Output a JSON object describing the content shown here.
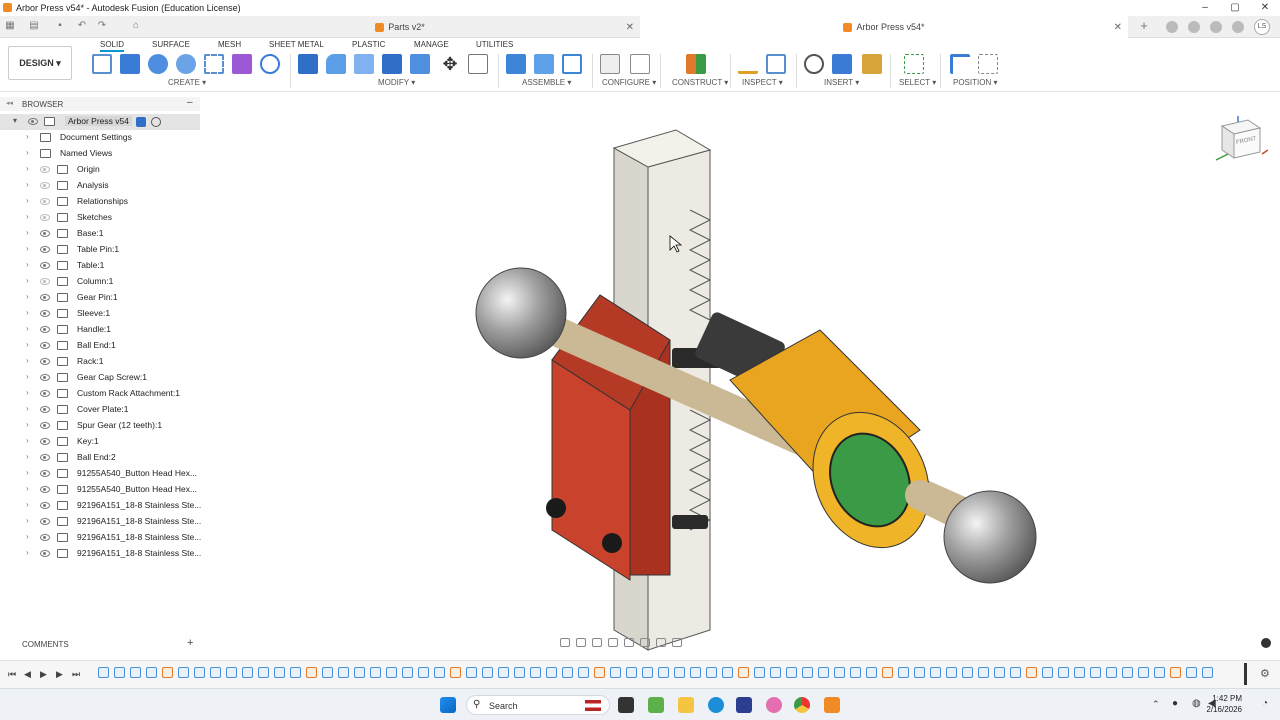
{
  "window": {
    "title": "Arbor Press v54* - Autodesk Fusion (Education License)",
    "controls": [
      "–",
      "▢",
      "✕"
    ]
  },
  "tabs": [
    {
      "label": "Parts v2*",
      "active": false
    },
    {
      "label": "Arbor Press v54*",
      "active": true
    }
  ],
  "user_initials": "LS",
  "ribbon": {
    "workspace": "DESIGN",
    "tabs": [
      "SOLID",
      "SURFACE",
      "MESH",
      "SHEET METAL",
      "PLASTIC",
      "MANAGE",
      "UTILITIES"
    ],
    "active_tab": "SOLID",
    "groups": [
      "CREATE ▾",
      "MODIFY ▾",
      "ASSEMBLE ▾",
      "CONFIGURE ▾",
      "CONSTRUCT ▾",
      "INSPECT ▾",
      "INSERT ▾",
      "SELECT ▾",
      "POSITION ▾"
    ]
  },
  "browser": {
    "title": "BROWSER",
    "root": "Arbor Press v54",
    "items": [
      {
        "label": "Document Settings",
        "visible": false
      },
      {
        "label": "Named Views",
        "visible": false
      },
      {
        "label": "Origin",
        "visible": "dim"
      },
      {
        "label": "Analysis",
        "visible": "dim"
      },
      {
        "label": "Relationships",
        "visible": "dim"
      },
      {
        "label": "Sketches",
        "visible": "dim"
      },
      {
        "label": "Base:1",
        "visible": true
      },
      {
        "label": "Table Pin:1",
        "visible": true
      },
      {
        "label": "Table:1",
        "visible": true
      },
      {
        "label": "Column:1",
        "visible": "dim"
      },
      {
        "label": "Gear Pin:1",
        "visible": true
      },
      {
        "label": "Sleeve:1",
        "visible": true
      },
      {
        "label": "Handle:1",
        "visible": true
      },
      {
        "label": "Ball End:1",
        "visible": true
      },
      {
        "label": "Rack:1",
        "visible": true
      },
      {
        "label": "Gear Cap Screw:1",
        "visible": true
      },
      {
        "label": "Custom Rack Attachment:1",
        "visible": true
      },
      {
        "label": "Cover Plate:1",
        "visible": true
      },
      {
        "label": "Spur Gear (12 teeth):1",
        "visible": true
      },
      {
        "label": "Key:1",
        "visible": true
      },
      {
        "label": "Ball End:2",
        "visible": true
      },
      {
        "label": "91255A540_Button Head Hex...",
        "visible": true
      },
      {
        "label": "91255A540_Button Head Hex...",
        "visible": true
      },
      {
        "label": "92196A151_18-8 Stainless Ste...",
        "visible": true
      },
      {
        "label": "92196A151_18-8 Stainless Ste...",
        "visible": true
      },
      {
        "label": "92196A151_18-8 Stainless Ste...",
        "visible": true
      },
      {
        "label": "92196A151_18-8 Stainless Ste...",
        "visible": true
      }
    ]
  },
  "comments": {
    "label": "COMMENTS",
    "add": "+"
  },
  "viewcube": {
    "face": "FRONT"
  },
  "taskbar": {
    "search_placeholder": "Search",
    "time": "1:42 PM",
    "date": "2/16/2026"
  },
  "colors": {
    "accent": "#0696d7",
    "column": "#e9e6dc",
    "table_red": "#c9432c",
    "sleeve_yellow": "#f0b429",
    "cap_green": "#3a9a45",
    "handle": "#dcc9a6",
    "ball": "#9a9a9a"
  }
}
